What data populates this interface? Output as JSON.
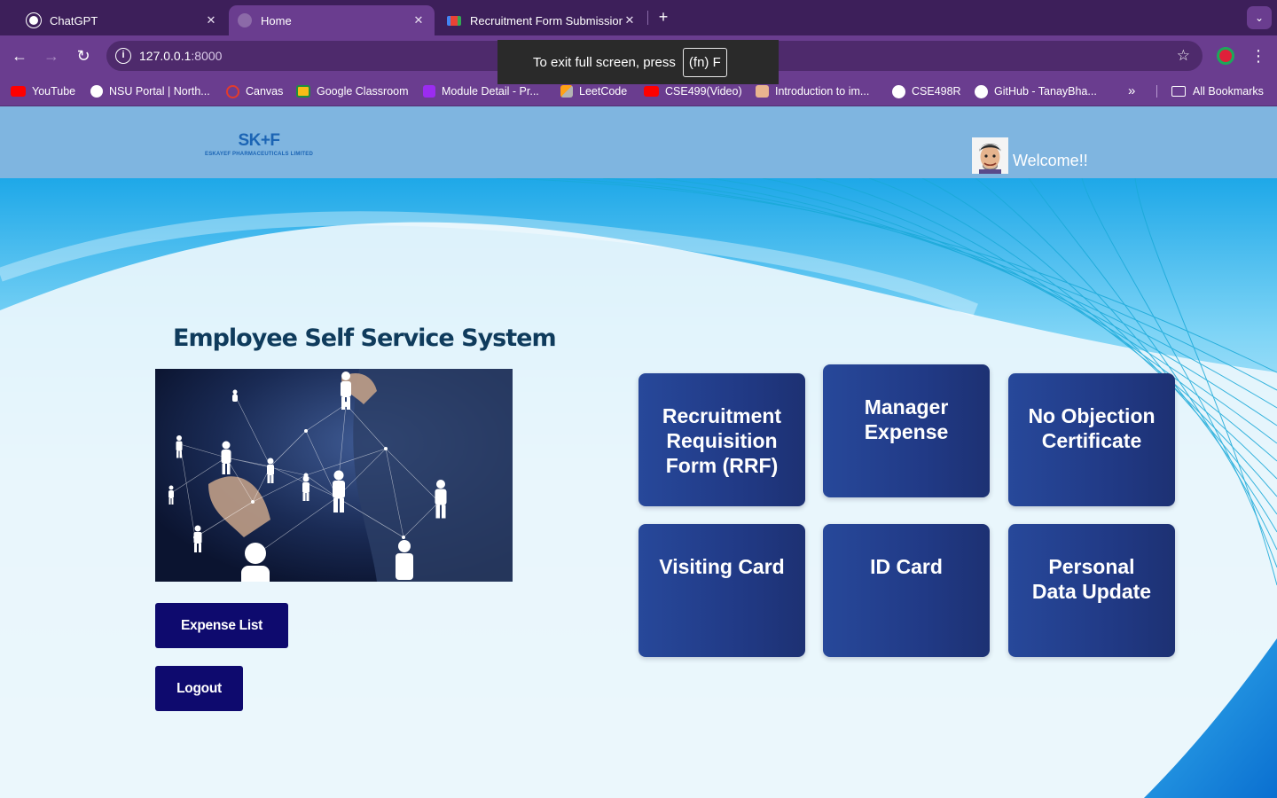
{
  "browser": {
    "tabs": [
      {
        "title": "ChatGPT",
        "active": false
      },
      {
        "title": "Home",
        "active": true
      },
      {
        "title": "Recruitment Form Submission",
        "active": false
      }
    ],
    "url_host": "127.0.0.1",
    "url_port": ":8000",
    "fullscreen_toast": {
      "text": "To exit full screen, press",
      "key": "(fn) F"
    },
    "bookmarks": [
      {
        "label": "YouTube",
        "icon": "youtube-icon"
      },
      {
        "label": "NSU Portal | North...",
        "icon": "globe-icon"
      },
      {
        "label": "Canvas",
        "icon": "canvas-icon"
      },
      {
        "label": "Google Classroom",
        "icon": "classroom-icon"
      },
      {
        "label": "Module Detail - Pr...",
        "icon": "module-icon"
      },
      {
        "label": "LeetCode",
        "icon": "leetcode-icon"
      },
      {
        "label": "CSE499(Video)",
        "icon": "youtube-icon"
      },
      {
        "label": "Introduction to im...",
        "icon": "avatar-icon"
      },
      {
        "label": "CSE498R",
        "icon": "github-icon"
      },
      {
        "label": "GitHub - TanayBha...",
        "icon": "github-icon"
      }
    ],
    "all_bookmarks": "All Bookmarks"
  },
  "header": {
    "logo_mark": "SK+F",
    "logo_company": "ESKAYEF PHARMACEUTICALS LIMITED",
    "welcome": "Welcome!!"
  },
  "main": {
    "title": "Employee Self Service System",
    "buttons": {
      "expense_list": "Expense List",
      "logout": "Logout"
    }
  },
  "cards": [
    {
      "label": "Recruitment Requisition Form (RRF)"
    },
    {
      "label": "Manager Expense"
    },
    {
      "label": "No Objection Certificate"
    },
    {
      "label": "Visiting Card"
    },
    {
      "label": "ID Card"
    },
    {
      "label": "Personal Data Update"
    }
  ],
  "colors": {
    "chrome_dark": "#3d1f5a",
    "chrome": "#6a3d8f",
    "header": "#7fb5e0",
    "card": "#213a86",
    "button": "#0e0a6e",
    "title": "#0f3b5c"
  }
}
